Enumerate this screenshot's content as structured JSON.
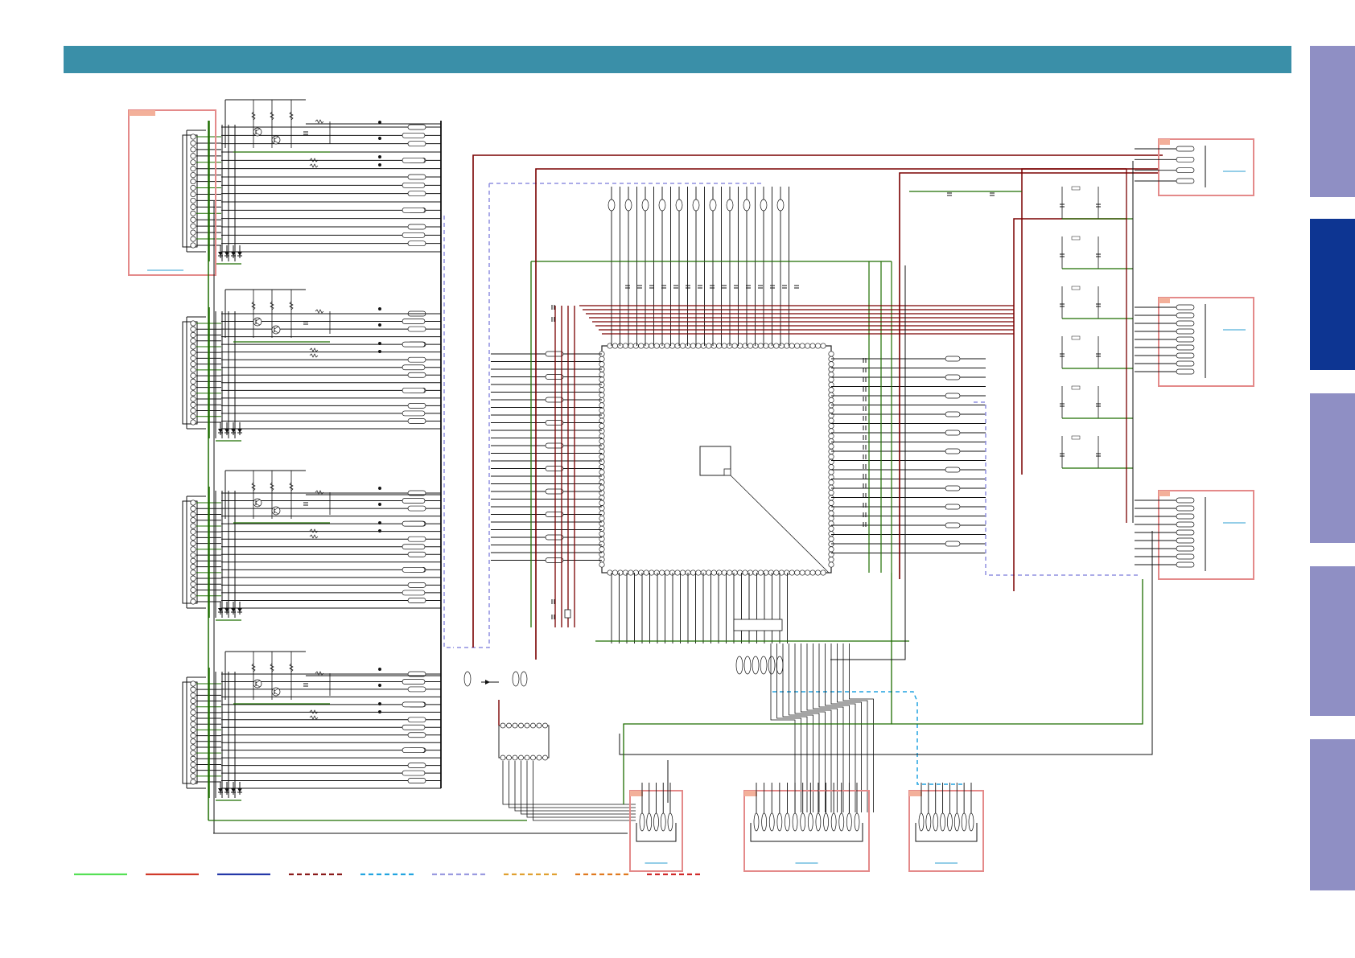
{
  "header": {
    "color": "#3a8fa8"
  },
  "side_tabs": [
    {
      "id": "tab-1",
      "active": false,
      "color": "#8f8fc4"
    },
    {
      "id": "tab-2",
      "active": true,
      "color": "#0d3592"
    },
    {
      "id": "tab-3",
      "active": false,
      "color": "#8f8fc4"
    },
    {
      "id": "tab-4",
      "active": false,
      "color": "#8f8fc4"
    },
    {
      "id": "tab-5",
      "active": false,
      "color": "#8f8fc4"
    }
  ],
  "colors": {
    "wire": "#111111",
    "ground": "#1e6e00",
    "supply": "#7a0000",
    "bus": "#8f8fe0",
    "bus_cyan": "#22a4e0",
    "connector_box": "#e48a8a",
    "connector_tag": "#f3b09a",
    "link": "#2a9ed0",
    "chip": "#222222"
  },
  "legend": [
    {
      "id": "solid-green",
      "color": "#55e055",
      "style": "solid"
    },
    {
      "id": "solid-red",
      "color": "#d03a2a",
      "style": "solid"
    },
    {
      "id": "solid-blue",
      "color": "#2438a8",
      "style": "solid"
    },
    {
      "id": "dash-maroon",
      "color": "#8a1a1a",
      "style": "dashed"
    },
    {
      "id": "dash-cyan",
      "color": "#22a4e0",
      "style": "dashed"
    },
    {
      "id": "dash-lavender",
      "color": "#9a9ae0",
      "style": "dashed"
    },
    {
      "id": "dash-orange",
      "color": "#e0a030",
      "style": "dashed"
    },
    {
      "id": "dash-orange2",
      "color": "#e07a20",
      "style": "dashed"
    },
    {
      "id": "dash-red",
      "color": "#d02a2a",
      "style": "dashed"
    }
  ]
}
